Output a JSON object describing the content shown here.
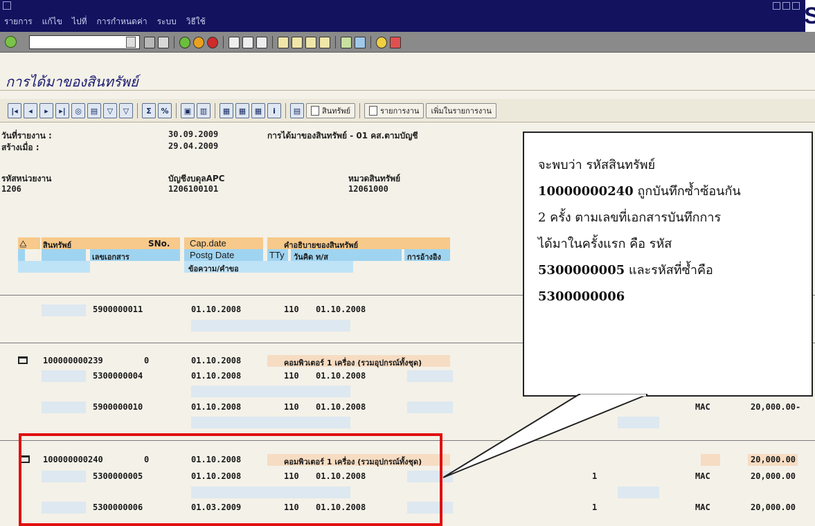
{
  "window": {
    "menu": [
      "รายการ",
      "แก้ไข",
      "ไปที่",
      "การกำหนดค่า",
      "ระบบ",
      "วิธีใช้"
    ],
    "logo": "S"
  },
  "toolbar": {
    "command_value": ""
  },
  "screen": {
    "title": "การได้มาของสินทรัพย์"
  },
  "app_toolbar": {
    "asset_btn": "สินทรัพย์",
    "worklist_btn": "รายการงาน",
    "add_worklist_btn": "เพิ่มในรายการงาน"
  },
  "header": {
    "report_date_label": "วันที่รายงาน :",
    "report_date": "30.09.2009",
    "report_title": "การได้มาของสินทรัพย์ - 01 คส.ตามบัญชี",
    "created_label": "สร้างเมื่อ :",
    "created": "29.04.2009",
    "company_label": "รหัสหน่วยงาน",
    "company": "1206",
    "apc_label": "บัญชีงบดุลAPC",
    "apc": "1206100101",
    "asset_class_label": "หมวดสินทรัพย์",
    "asset_class": "12061000"
  },
  "columns": {
    "asset": "สินทรัพย์",
    "sno": "SNo.",
    "cap_date": "Cap.date",
    "description": "คำอธิบายของสินทรัพย์",
    "doc_no": "เลขเอกสาร",
    "postg_date": "Postg Date",
    "tty": "TTy",
    "value_date": "วันคิด ท/ส",
    "reference": "การอ้างอิง",
    "text": "ข้อความ/คำขอ"
  },
  "rows": {
    "r1_doc": "5900000011",
    "r1_post": "01.10.2008",
    "r1_tty": "110",
    "r1_val": "01.10.2008",
    "a1_asset": "100000000239",
    "a1_sno": "0",
    "a1_cap": "01.10.2008",
    "a1_desc": "คอมพิวเตอร์ 1 เครื่อง (รวมอุปกรณ์ทั้งชุด)",
    "a1_d1_doc": "5300000004",
    "a1_d1_post": "01.10.2008",
    "a1_d1_tty": "110",
    "a1_d1_val": "01.10.2008",
    "a1_d2_doc": "5900000010",
    "a1_d2_post": "01.10.2008",
    "a1_d2_tty": "110",
    "a1_d2_val": "01.10.2008",
    "a1_d2_type": "MAC",
    "a1_d2_amt": "20,000.00-",
    "a2_asset": "100000000240",
    "a2_sno": "0",
    "a2_cap": "01.10.2008",
    "a2_desc": "คอมพิวเตอร์ 1 เครื่อง (รวมอุปกรณ์ทั้งชุด)",
    "a2_amt": "20,000.00",
    "a2_d1_doc": "5300000005",
    "a2_d1_post": "01.10.2008",
    "a2_d1_tty": "110",
    "a2_d1_val": "01.10.2008",
    "a2_d1_qty": "1",
    "a2_d1_type": "MAC",
    "a2_d1_amt": "20,000.00",
    "a2_d2_doc": "5300000006",
    "a2_d2_post": "01.03.2009",
    "a2_d2_tty": "110",
    "a2_d2_val": "01.10.2008",
    "a2_d2_qty": "1",
    "a2_d2_type": "MAC",
    "a2_d2_amt": "20,000.00"
  },
  "callout": {
    "line1": "จะพบว่า รหัสสินทรัพย์",
    "asset_code": "10000000240",
    "line2_rest": " ถูกบันทึกซ้ำซ้อนกัน",
    "line3": "2 ครั้ง  ตามเลขที่เอกสารบันทึกการ",
    "line4": "ได้มาในครั้งแรก คือ รหัส",
    "code1": "5300000005",
    "line5_rest": " และรหัสที่ซ้ำคือ",
    "code2": "5300000006"
  },
  "colors": {
    "title_bar": "#12125e",
    "highlight": "#e11010",
    "header_orange": "#f7c98a",
    "header_blue": "#9fd4f1"
  }
}
